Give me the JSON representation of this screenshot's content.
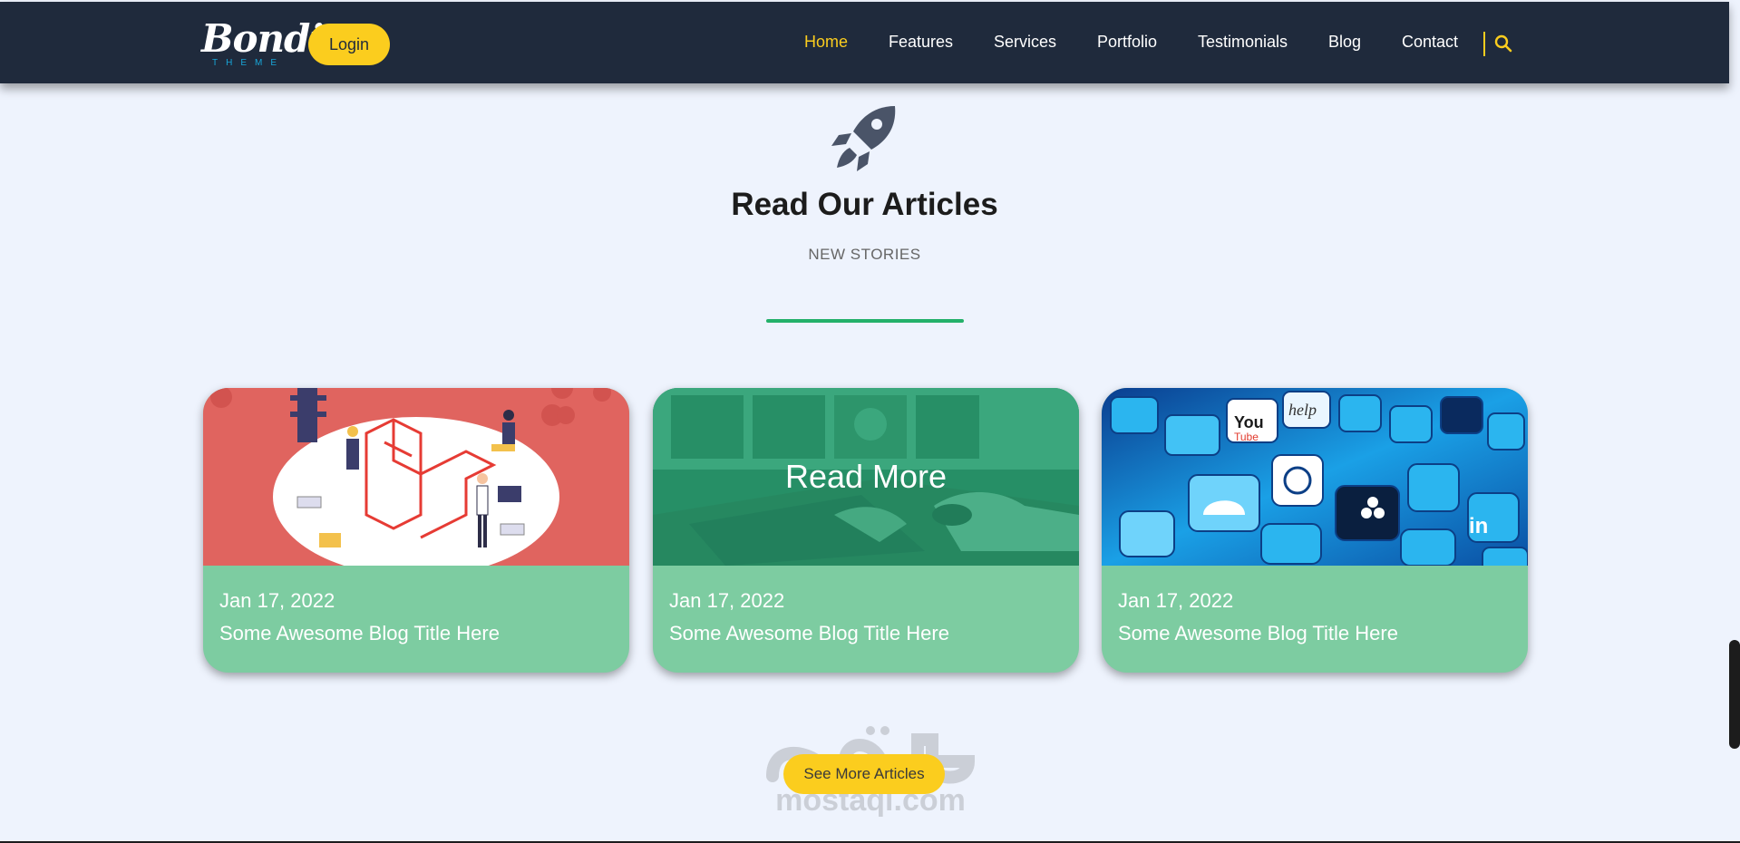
{
  "header": {
    "logo": {
      "word": "Bondi",
      "sub": "THEME"
    },
    "login_label": "Login",
    "nav": [
      "Home",
      "Features",
      "Services",
      "Portfolio",
      "Testimonials",
      "Blog",
      "Contact"
    ],
    "active_nav": "Home",
    "search_icon": "search-icon"
  },
  "section": {
    "icon": "rocket-icon",
    "title": "Read Our Articles",
    "subtitle": "NEW STORIES"
  },
  "cards": [
    {
      "date": "Jan 17, 2022",
      "title": "Some Awesome Blog Title Here",
      "image": "laravel-illustration"
    },
    {
      "date": "Jan 17, 2022",
      "title": "Some Awesome Blog Title Here",
      "image": "laptop-typing",
      "overlay": "Read More"
    },
    {
      "date": "Jan 17, 2022",
      "title": "Some Awesome Blog Title Here",
      "image": "social-media-icons"
    }
  ],
  "see_more_label": "See More Articles",
  "watermark": {
    "text": "mostaql.com"
  },
  "colors": {
    "nav_bg": "#1f2a3c",
    "accent_yellow": "#fbcd1e",
    "accent_green": "#23b06a",
    "card_bg": "#7dcca1",
    "page_bg": "#eef3fd"
  }
}
